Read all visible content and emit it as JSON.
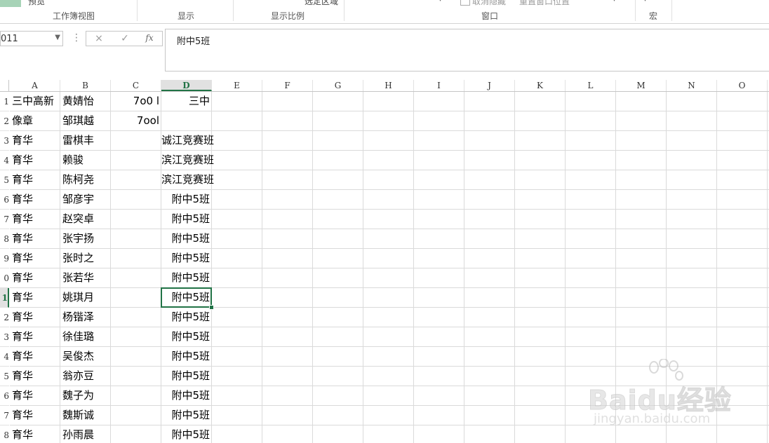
{
  "ribbon": {
    "top_labels": [
      "预览",
      "选定区域",
      "取消隐藏",
      "重置窗口位置"
    ],
    "groups": [
      "工作簿视图",
      "显示",
      "显示比例",
      "窗口",
      "宏"
    ]
  },
  "formula_bar": {
    "name_box": "D11",
    "name_box_visible": "011",
    "cancel_icon": "×",
    "enter_icon": "✓",
    "fx_label": "fx",
    "content": "附中5班"
  },
  "grid": {
    "columns": [
      "A",
      "B",
      "C",
      "D",
      "E",
      "F",
      "G",
      "H",
      "I",
      "J",
      "K",
      "L",
      "M",
      "N",
      "O"
    ],
    "selected_column": "D",
    "row_numbers_visible": [
      "1",
      "2",
      "3",
      "4",
      "5",
      "6",
      "7",
      "8",
      "9",
      "0",
      "1",
      "2",
      "3",
      "4",
      "5",
      "6",
      "7",
      "8"
    ],
    "selected_row_index": 10,
    "rows": [
      {
        "a": "三中高新",
        "b": "黄婧怡",
        "c": "7o0 l",
        "d": "三中"
      },
      {
        "a": "像章",
        "b": "邹琪越",
        "c": "7ool",
        "d": ""
      },
      {
        "a": "育华",
        "b": "雷棋丰",
        "c": "",
        "d": "诚江竞赛班"
      },
      {
        "a": "育华",
        "b": "赖骏",
        "c": "",
        "d": "滨江竞赛班"
      },
      {
        "a": "育华",
        "b": "陈柯尧",
        "c": "",
        "d": "滨江竞赛班"
      },
      {
        "a": "育华",
        "b": "邹彦宇",
        "c": "",
        "d": "附中5班"
      },
      {
        "a": "育华",
        "b": "赵突卓",
        "c": "",
        "d": "附中5班"
      },
      {
        "a": "育华",
        "b": "张宇扬",
        "c": "",
        "d": "附中5班"
      },
      {
        "a": "育华",
        "b": "张时之",
        "c": "",
        "d": "附中5班"
      },
      {
        "a": "育华",
        "b": "张若华",
        "c": "",
        "d": "附中5班"
      },
      {
        "a": "育华",
        "b": "姚琪月",
        "c": "",
        "d": "附中5班"
      },
      {
        "a": "育华",
        "b": "杨锴泽",
        "c": "",
        "d": "附中5班"
      },
      {
        "a": "育华",
        "b": "徐佳璐",
        "c": "",
        "d": "附中5班"
      },
      {
        "a": "育华",
        "b": "吴俊杰",
        "c": "",
        "d": "附中5班"
      },
      {
        "a": "育华",
        "b": "翁亦豆",
        "c": "",
        "d": "附中5班"
      },
      {
        "a": "育华",
        "b": "魏子为",
        "c": "",
        "d": "附中5班"
      },
      {
        "a": "育华",
        "b": "魏斯诚",
        "c": "",
        "d": "附中5班"
      },
      {
        "a": "育华",
        "b": "孙雨晨",
        "c": "",
        "d": "附中5班"
      }
    ]
  },
  "watermark": {
    "logo": "Baidu经验",
    "url": "jingyan.baidu.com"
  },
  "colors": {
    "accent": "#217346",
    "gridline": "#dadada",
    "header_selected_bg": "#e1e1e1"
  }
}
